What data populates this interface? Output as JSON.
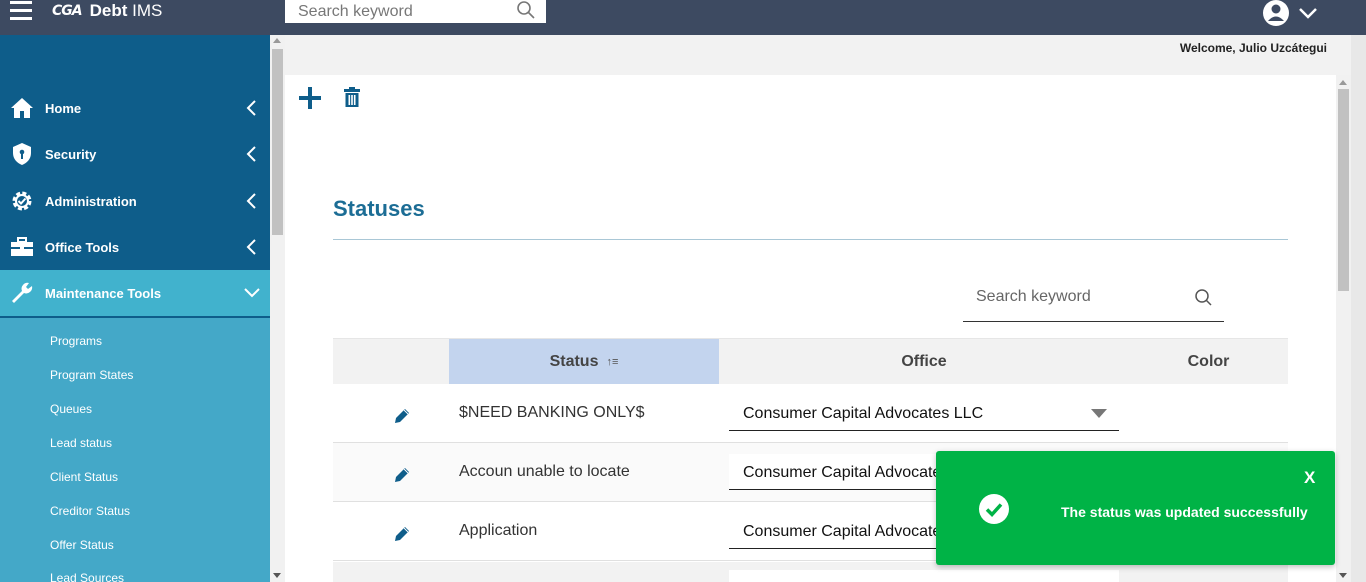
{
  "header": {
    "logo_mark": "CGA",
    "app_name_bold": "Debt",
    "app_name_light": " IMS",
    "search_placeholder": "Search keyword",
    "welcome": "Welcome, Julio Uzcátegui"
  },
  "sidebar": {
    "items": [
      {
        "label": "Home",
        "icon": "home-icon"
      },
      {
        "label": "Security",
        "icon": "shield-icon"
      },
      {
        "label": "Administration",
        "icon": "gear-icon"
      },
      {
        "label": "Office Tools",
        "icon": "briefcase-icon"
      },
      {
        "label": "Maintenance Tools",
        "icon": "wrench-icon",
        "expanded": true
      }
    ],
    "subitems": [
      "Programs",
      "Program States",
      "Queues",
      "Lead status",
      "Client Status",
      "Creditor Status",
      "Offer Status",
      "Lead Sources"
    ]
  },
  "page": {
    "title": "Statuses",
    "search_placeholder": "Search keyword"
  },
  "table": {
    "columns": [
      "Status",
      "Office",
      "Color"
    ],
    "sort_indicator": "↑≡",
    "rows": [
      {
        "status": "$NEED BANKING ONLY$",
        "office": "Consumer Capital Advocates LLC"
      },
      {
        "status": "Accoun unable to locate",
        "office": "Consumer Capital Advocates LLC"
      },
      {
        "status": "Application",
        "office": "Consumer Capital Advocates LLC"
      }
    ]
  },
  "toast": {
    "close_label": "X",
    "message": "The status was updated successfully"
  },
  "colors": {
    "topbar": "#3d4a61",
    "sidebar": "#0e5d8a",
    "sidebar_active": "#41b2cd",
    "accent": "#1c6d95",
    "toast": "#00b346"
  }
}
